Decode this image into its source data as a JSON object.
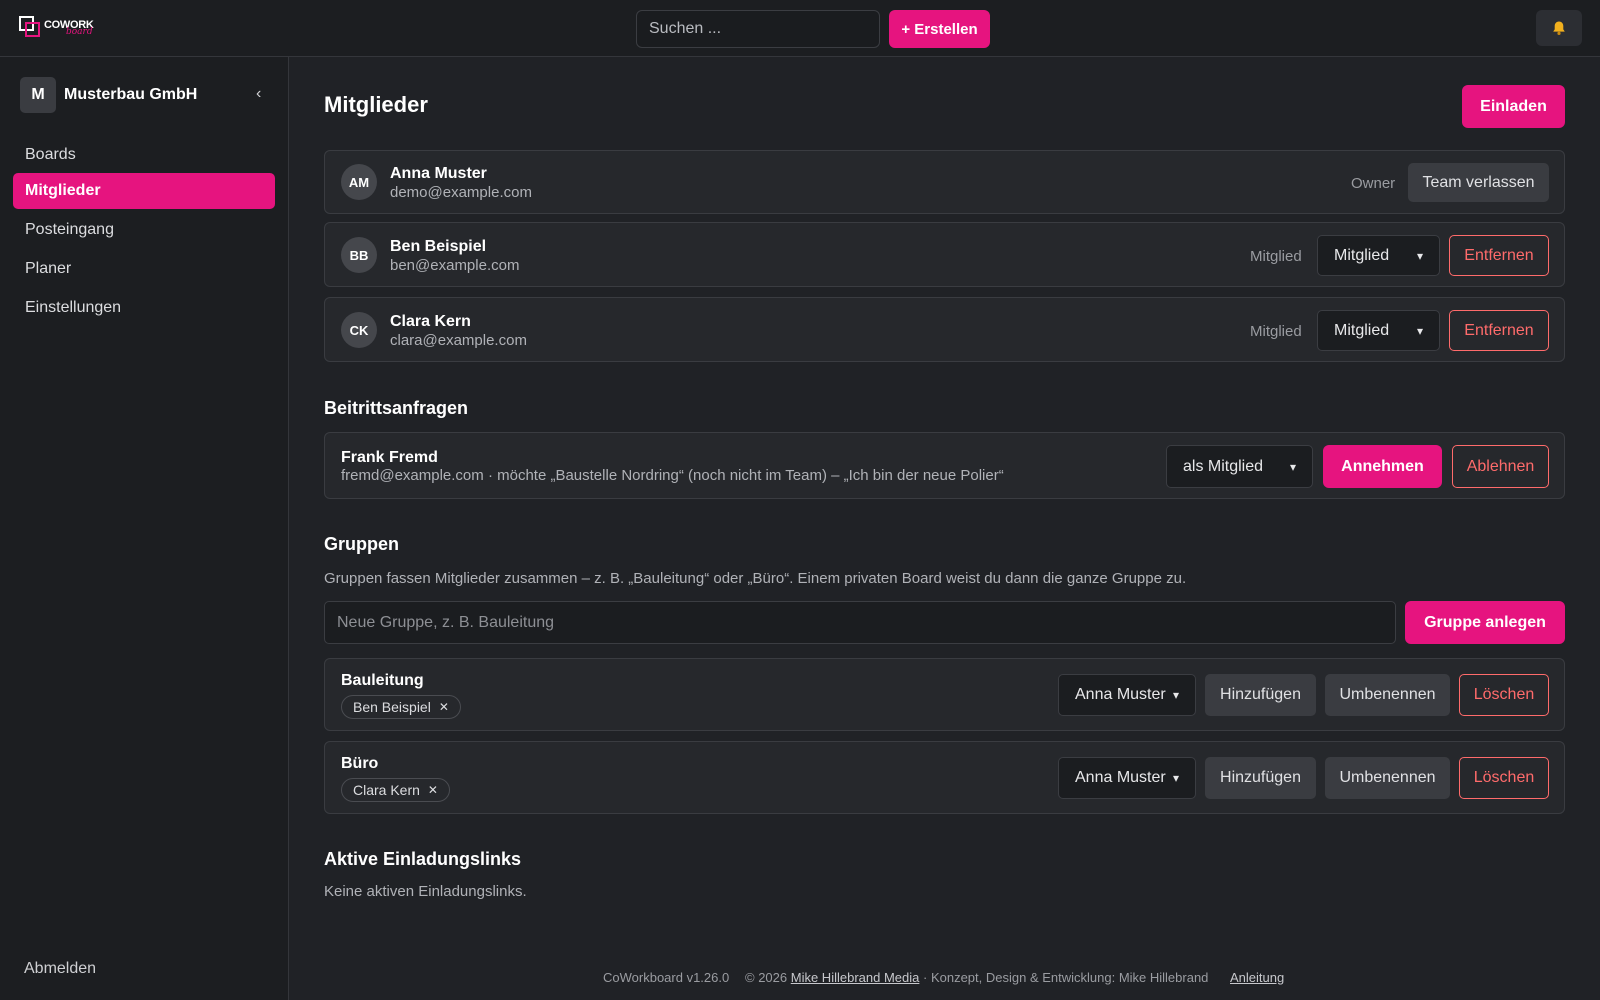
{
  "header": {
    "logo_word": "COWORK",
    "logo_sub": "board",
    "search_placeholder": "Suchen ...",
    "create_label": "+ Erstellen",
    "bell_icon": "bell-icon"
  },
  "sidebar": {
    "org_initial": "M",
    "org_name": "Musterbau GmbH",
    "collapse_icon": "‹",
    "items": [
      {
        "label": "Boards"
      },
      {
        "label": "Mitglieder"
      },
      {
        "label": "Posteingang"
      },
      {
        "label": "Planer"
      },
      {
        "label": "Einstellungen"
      }
    ],
    "logout_label": "Abmelden"
  },
  "members": {
    "title": "Mitglieder",
    "invite_label": "Einladen",
    "list": [
      {
        "initials": "AM",
        "name": "Anna Muster",
        "email": "demo@example.com",
        "role": "Owner",
        "action": "Team verlassen"
      },
      {
        "initials": "BB",
        "name": "Ben Beispiel",
        "email": "ben@example.com",
        "role": "Mitglied",
        "select": "Mitglied",
        "action": "Entfernen"
      },
      {
        "initials": "CK",
        "name": "Clara Kern",
        "email": "clara@example.com",
        "role": "Mitglied",
        "select": "Mitglied",
        "action": "Entfernen"
      }
    ]
  },
  "requests": {
    "title": "Beitrittsanfragen",
    "item": {
      "name": "Frank Fremd",
      "text": "fremd@example.com · möchte „Baustelle Nordring“ (noch nicht im Team) – „Ich bin der neue Polier“",
      "select": "als Mitglied",
      "accept": "Annehmen",
      "reject": "Ablehnen"
    }
  },
  "groups": {
    "title": "Gruppen",
    "description": "Gruppen fassen Mitglieder zusammen – z. B. „Bauleitung“ oder „Büro“. Einem privaten Board weist du dann die ganze Gruppe zu.",
    "input_placeholder": "Neue Gruppe, z. B. Bauleitung",
    "create_label": "Gruppe anlegen",
    "list": [
      {
        "name": "Bauleitung",
        "chip": "Ben Beispiel",
        "select": "Anna Muster",
        "add": "Hinzufügen",
        "rename": "Umbenennen",
        "delete": "Löschen"
      },
      {
        "name": "Büro",
        "chip": "Clara Kern",
        "select": "Anna Muster",
        "add": "Hinzufügen",
        "rename": "Umbenennen",
        "delete": "Löschen"
      }
    ]
  },
  "invites": {
    "title": "Aktive Einladungslinks",
    "empty": "Keine aktiven Einladungslinks."
  },
  "footer": {
    "version": "CoWorkboard v1.26.0",
    "copyright_prefix": "© 2026",
    "company_link": "Mike Hillebrand Media",
    "credits": "· Konzept, Design & Entwicklung: Mike Hillebrand",
    "guide_link": "Anleitung"
  },
  "colors": {
    "accent": "#e6147f",
    "danger": "#ff6b6b",
    "background": "#202226"
  }
}
